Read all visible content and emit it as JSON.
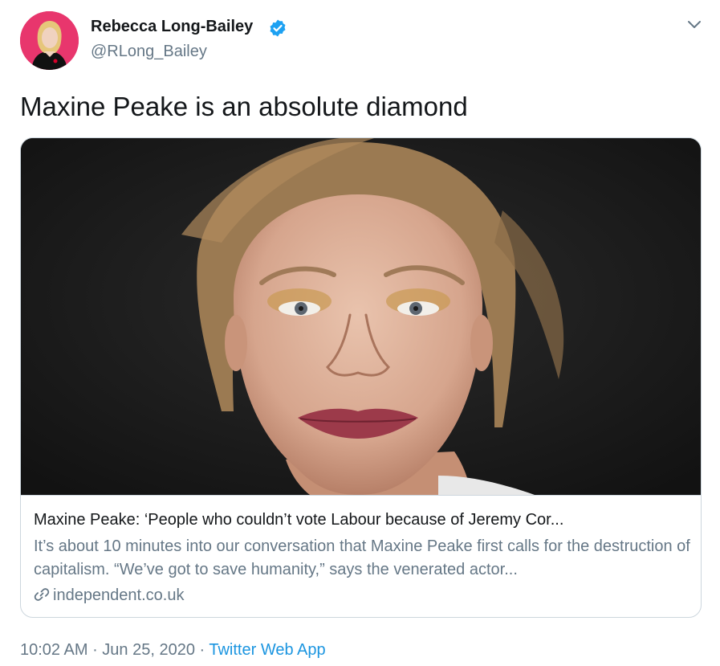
{
  "author": {
    "display_name": "Rebecca Long-Bailey",
    "handle": "@RLong_Bailey"
  },
  "icons": {
    "avatar": "profile-photo",
    "verified": "verified-badge-icon",
    "caret": "chevron-down-icon",
    "link": "link-icon"
  },
  "tweet": {
    "text": "Maxine Peake is an absolute diamond"
  },
  "card": {
    "title": "Maxine Peake: ‘People who couldn’t vote Labour because of Jeremy Cor...",
    "description": "It’s about 10 minutes into our conversation that Maxine Peake first calls for the destruction of capitalism. “We’ve got to save humanity,” says the venerated actor...",
    "domain": "independent.co.uk"
  },
  "meta": {
    "time": "10:02 AM",
    "separator1": " · ",
    "date": "Jun 25, 2020",
    "separator2": " · ",
    "source": "Twitter Web App"
  },
  "colors": {
    "text": "#14171a",
    "secondary": "#657786",
    "accent": "#1b95e0",
    "border": "#ccd6dd",
    "avatar_bg": "#e8366d"
  }
}
